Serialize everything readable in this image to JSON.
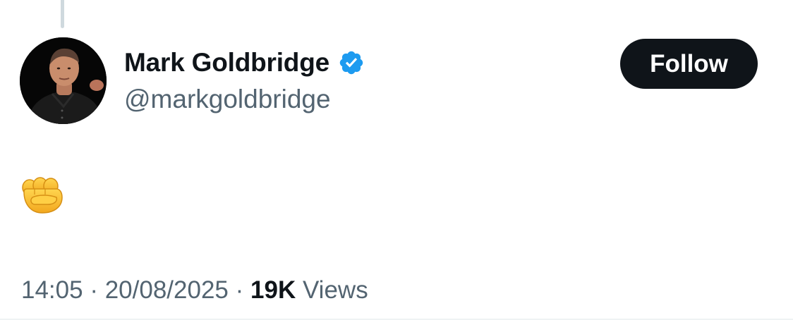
{
  "tweet": {
    "author": {
      "name": "Mark Goldbridge",
      "handle": "@markgoldbridge",
      "verified": true
    },
    "follow_label": "Follow",
    "text": "👊",
    "time": "14:05",
    "separator": "·",
    "date": "20/08/2025",
    "views_count": "19K",
    "views_label": "Views"
  },
  "colors": {
    "verified_badge": "#1d9bf0",
    "follow_button_bg": "#0f1419",
    "secondary_text": "#536471",
    "primary_text": "#0f1419",
    "fist_emoji": "#f7c23d"
  },
  "icons": {
    "verified": "verified-badge-icon",
    "tweet_emoji": "oncoming-fist-emoji"
  }
}
